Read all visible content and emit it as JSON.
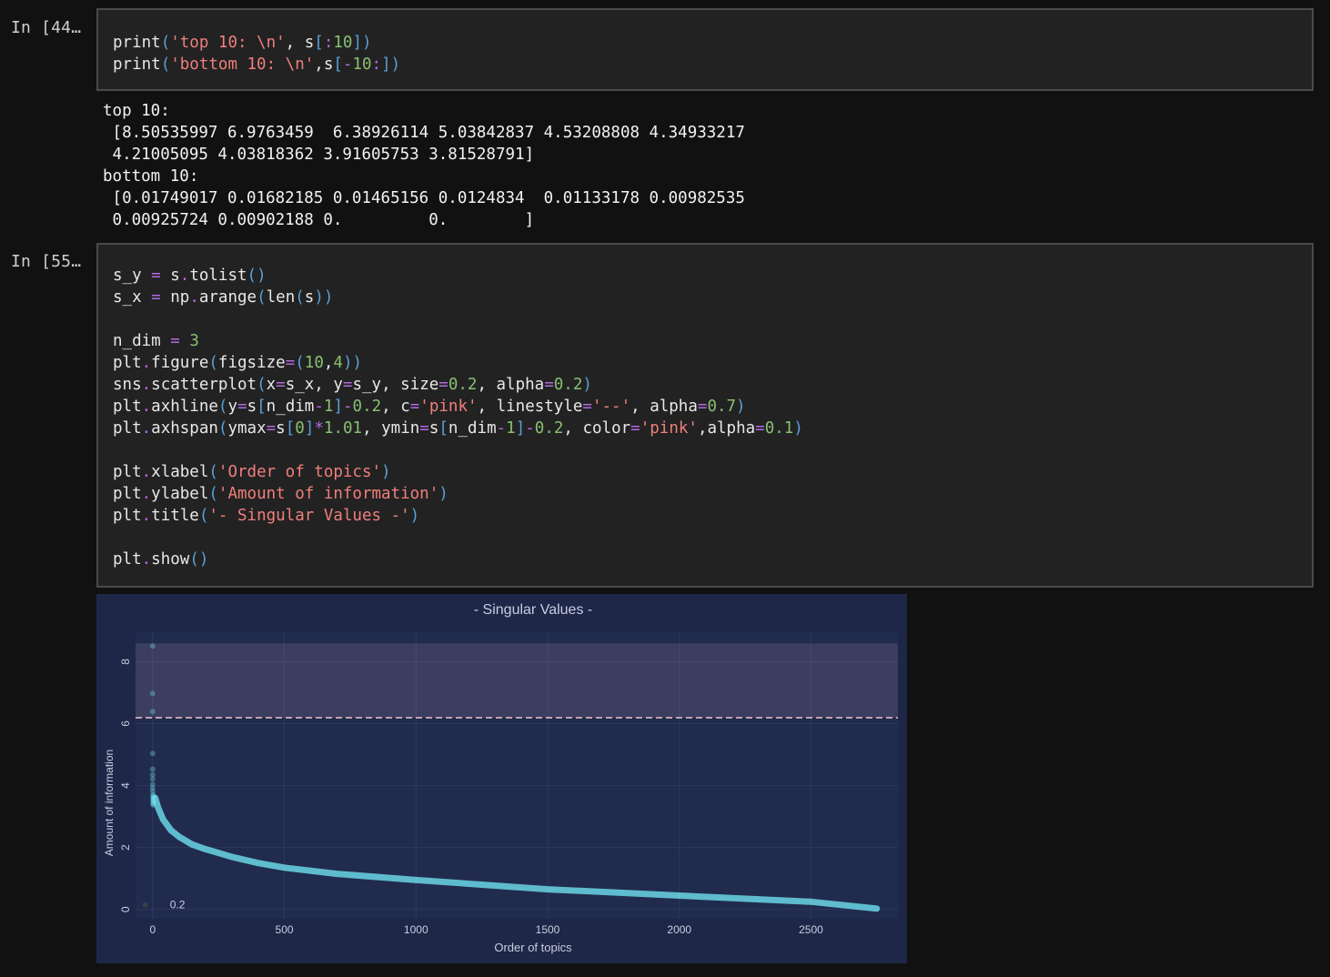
{
  "cells": [
    {
      "prompt": "In [44…",
      "code": [
        [
          [
            "print",
            "pl"
          ],
          [
            "(",
            "br"
          ],
          [
            "'top 10: \\n'",
            "st"
          ],
          [
            ", ",
            "pl"
          ],
          [
            "s",
            "pl"
          ],
          [
            "[",
            "br"
          ],
          [
            ":",
            "op"
          ],
          [
            "10",
            "nm"
          ],
          [
            "]",
            "br"
          ],
          [
            ")",
            "br"
          ]
        ],
        [
          [
            "print",
            "pl"
          ],
          [
            "(",
            "br"
          ],
          [
            "'bottom 10: \\n'",
            "st"
          ],
          [
            ",",
            "pl"
          ],
          [
            "s",
            "pl"
          ],
          [
            "[",
            "br"
          ],
          [
            "-",
            "op"
          ],
          [
            "10",
            "nm"
          ],
          [
            ":",
            "op"
          ],
          [
            "]",
            "br"
          ],
          [
            ")",
            "br"
          ]
        ]
      ],
      "output": [
        "top 10:",
        " [8.50535997 6.9763459  6.38926114 5.03842837 4.53208808 4.34933217",
        " 4.21005095 4.03818362 3.91605753 3.81528791]",
        "bottom 10:",
        " [0.01749017 0.01682185 0.01465156 0.0124834  0.01133178 0.00982535",
        " 0.00925724 0.00902188 0.         0.        ]"
      ]
    },
    {
      "prompt": "In [55…",
      "code": [
        [
          [
            "s_y ",
            "pl"
          ],
          [
            "=",
            "op"
          ],
          [
            " s",
            "pl"
          ],
          [
            ".",
            "op"
          ],
          [
            "tolist",
            "pl"
          ],
          [
            "()",
            "br"
          ]
        ],
        [
          [
            "s_x ",
            "pl"
          ],
          [
            "=",
            "op"
          ],
          [
            " np",
            "pl"
          ],
          [
            ".",
            "op"
          ],
          [
            "arange",
            "pl"
          ],
          [
            "(",
            "br"
          ],
          [
            "len",
            "pl"
          ],
          [
            "(",
            "br"
          ],
          [
            "s",
            "pl"
          ],
          [
            "))",
            "br"
          ]
        ],
        [],
        [
          [
            "n_dim ",
            "pl"
          ],
          [
            "=",
            "op"
          ],
          [
            " ",
            "pl"
          ],
          [
            "3",
            "nm"
          ]
        ],
        [
          [
            "plt",
            "pl"
          ],
          [
            ".",
            "op"
          ],
          [
            "figure",
            "pl"
          ],
          [
            "(",
            "br"
          ],
          [
            "figsize",
            "pl"
          ],
          [
            "=",
            "op"
          ],
          [
            "(",
            "br"
          ],
          [
            "10",
            "nm"
          ],
          [
            ",",
            "pl"
          ],
          [
            "4",
            "nm"
          ],
          [
            "))",
            "br"
          ]
        ],
        [
          [
            "sns",
            "pl"
          ],
          [
            ".",
            "op"
          ],
          [
            "scatterplot",
            "pl"
          ],
          [
            "(",
            "br"
          ],
          [
            "x",
            "pl"
          ],
          [
            "=",
            "op"
          ],
          [
            "s_x, y",
            "pl"
          ],
          [
            "=",
            "op"
          ],
          [
            "s_y, size",
            "pl"
          ],
          [
            "=",
            "op"
          ],
          [
            "0.2",
            "nm"
          ],
          [
            ", alpha",
            "pl"
          ],
          [
            "=",
            "op"
          ],
          [
            "0.2",
            "nm"
          ],
          [
            ")",
            "br"
          ]
        ],
        [
          [
            "plt",
            "pl"
          ],
          [
            ".",
            "op"
          ],
          [
            "axhline",
            "pl"
          ],
          [
            "(",
            "br"
          ],
          [
            "y",
            "pl"
          ],
          [
            "=",
            "op"
          ],
          [
            "s",
            "pl"
          ],
          [
            "[",
            "br"
          ],
          [
            "n_dim",
            "pl"
          ],
          [
            "-",
            "op"
          ],
          [
            "1",
            "nm"
          ],
          [
            "]",
            "br"
          ],
          [
            "-",
            "op"
          ],
          [
            "0.2",
            "nm"
          ],
          [
            ", c",
            "pl"
          ],
          [
            "=",
            "op"
          ],
          [
            "'pink'",
            "st"
          ],
          [
            ", linestyle",
            "pl"
          ],
          [
            "=",
            "op"
          ],
          [
            "'--'",
            "st"
          ],
          [
            ", alpha",
            "pl"
          ],
          [
            "=",
            "op"
          ],
          [
            "0.7",
            "nm"
          ],
          [
            ")",
            "br"
          ]
        ],
        [
          [
            "plt",
            "pl"
          ],
          [
            ".",
            "op"
          ],
          [
            "axhspan",
            "pl"
          ],
          [
            "(",
            "br"
          ],
          [
            "ymax",
            "pl"
          ],
          [
            "=",
            "op"
          ],
          [
            "s",
            "pl"
          ],
          [
            "[",
            "br"
          ],
          [
            "0",
            "nm"
          ],
          [
            "]",
            "br"
          ],
          [
            "*",
            "op"
          ],
          [
            "1.01",
            "nm"
          ],
          [
            ", ymin",
            "pl"
          ],
          [
            "=",
            "op"
          ],
          [
            "s",
            "pl"
          ],
          [
            "[",
            "br"
          ],
          [
            "n_dim",
            "pl"
          ],
          [
            "-",
            "op"
          ],
          [
            "1",
            "nm"
          ],
          [
            "]",
            "br"
          ],
          [
            "-",
            "op"
          ],
          [
            "0.2",
            "nm"
          ],
          [
            ", color",
            "pl"
          ],
          [
            "=",
            "op"
          ],
          [
            "'pink'",
            "st"
          ],
          [
            ",alpha",
            "pl"
          ],
          [
            "=",
            "op"
          ],
          [
            "0.1",
            "nm"
          ],
          [
            ")",
            "br"
          ]
        ],
        [],
        [
          [
            "plt",
            "pl"
          ],
          [
            ".",
            "op"
          ],
          [
            "xlabel",
            "pl"
          ],
          [
            "(",
            "br"
          ],
          [
            "'Order of topics'",
            "st"
          ],
          [
            ")",
            "br"
          ]
        ],
        [
          [
            "plt",
            "pl"
          ],
          [
            ".",
            "op"
          ],
          [
            "ylabel",
            "pl"
          ],
          [
            "(",
            "br"
          ],
          [
            "'Amount of information'",
            "st"
          ],
          [
            ")",
            "br"
          ]
        ],
        [
          [
            "plt",
            "pl"
          ],
          [
            ".",
            "op"
          ],
          [
            "title",
            "pl"
          ],
          [
            "(",
            "br"
          ],
          [
            "'- Singular Values -'",
            "st"
          ],
          [
            ")",
            "br"
          ]
        ],
        [],
        [
          [
            "plt",
            "pl"
          ],
          [
            ".",
            "op"
          ],
          [
            "show",
            "pl"
          ],
          [
            "()",
            "br"
          ]
        ]
      ]
    }
  ],
  "chart_data": {
    "type": "scatter",
    "title": "- Singular Values -",
    "xlabel": "Order of topics",
    "ylabel": "Amount of information",
    "xlim": [
      -65,
      2830
    ],
    "ylim": [
      -0.3,
      8.95
    ],
    "xticks": [
      0,
      500,
      1000,
      1500,
      2000,
      2500
    ],
    "yticks": [
      0,
      2,
      4,
      6,
      8
    ],
    "legend_label": "0.2",
    "top_values": [
      8.50535997,
      6.9763459,
      6.38926114,
      5.03842837,
      4.53208808,
      4.34933217,
      4.21005095,
      4.03818362,
      3.91605753,
      3.81528791
    ],
    "curve_points": [
      [
        10,
        3.6
      ],
      [
        20,
        3.3
      ],
      [
        40,
        2.9
      ],
      [
        70,
        2.55
      ],
      [
        100,
        2.35
      ],
      [
        150,
        2.1
      ],
      [
        200,
        1.95
      ],
      [
        300,
        1.7
      ],
      [
        400,
        1.5
      ],
      [
        500,
        1.35
      ],
      [
        700,
        1.15
      ],
      [
        1000,
        0.95
      ],
      [
        1500,
        0.65
      ],
      [
        2000,
        0.45
      ],
      [
        2500,
        0.25
      ],
      [
        2750,
        0.03
      ]
    ],
    "axhline_y": 6.19,
    "axhspan": [
      6.19,
      8.59
    ],
    "point_color": "#6fe0ef",
    "line_color": "#f0c4cf",
    "background": "#1e2747"
  }
}
